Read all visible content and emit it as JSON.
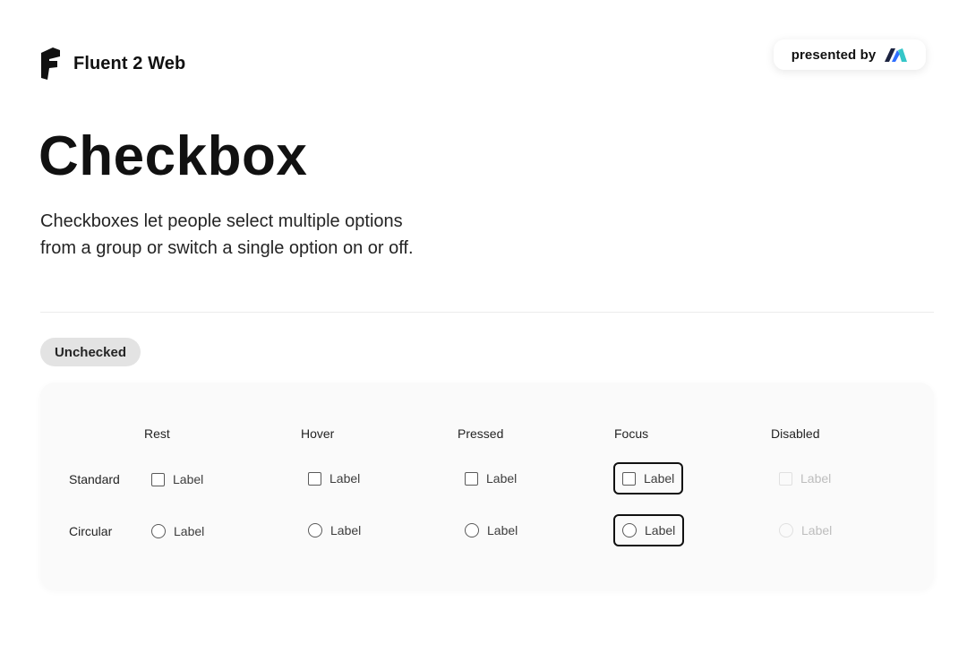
{
  "header": {
    "brand_name": "Fluent 2 Web",
    "presented_by": "presented by",
    "brand_logo_icon": "fluent-logo-icon",
    "presenter_logo_icon": "presenter-logo-icon"
  },
  "page": {
    "title": "Checkbox",
    "description_line1": "Checkboxes let people select multiple options",
    "description_line2": "from a group or switch a single option on or off."
  },
  "section": {
    "badge": "Unchecked"
  },
  "matrix": {
    "columns": [
      "Rest",
      "Hover",
      "Pressed",
      "Focus",
      "Disabled"
    ],
    "rows": [
      "Standard",
      "Circular"
    ],
    "item_label": "Label"
  },
  "colors": {
    "text": "#111111",
    "panel_background": "#fafafa",
    "badge_background": "#e3e3e3",
    "control_border": "#5a5a5a",
    "disabled_border": "#e0e0e0",
    "presenter_accent_blue": "#2f6fff",
    "presenter_accent_teal": "#35c6c8"
  }
}
